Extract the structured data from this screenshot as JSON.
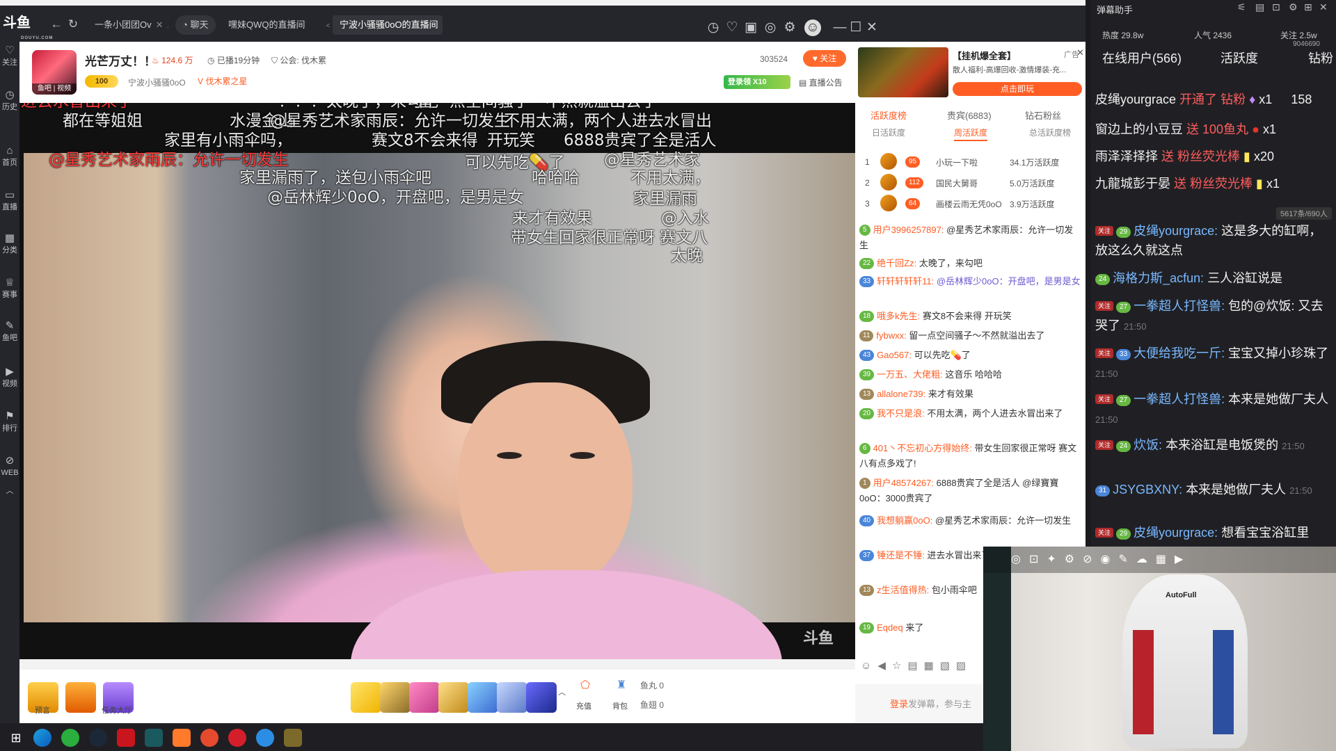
{
  "titlebar": {
    "logo": "斗鱼",
    "logo_sub": "DOUYU.COM",
    "tabs": [
      {
        "label": "一条小团团Ov"
      },
      {
        "label": "聊天"
      },
      {
        "label": "嘿妹QWQ的直播间"
      },
      {
        "label": "宁波小骚骚0oO的直播间"
      }
    ]
  },
  "rail": [
    {
      "label": "关注",
      "icon": "heart-icon"
    },
    {
      "label": "历史",
      "icon": "clock-icon"
    },
    {
      "label": "首页",
      "icon": "home-icon"
    },
    {
      "label": "直播",
      "icon": "tv-icon"
    },
    {
      "label": "分类",
      "icon": "grid-icon"
    },
    {
      "label": "赛事",
      "icon": "trophy-icon"
    },
    {
      "label": "鱼吧",
      "icon": "pen-icon"
    },
    {
      "label": "视频",
      "icon": "video-icon"
    },
    {
      "label": "排行",
      "icon": "bookmark-icon"
    },
    {
      "label": "WEB",
      "icon": "web-icon"
    }
  ],
  "room": {
    "avatar_tag": "鱼吧 | 视频",
    "title": "光芒万丈！！",
    "hot": "124.6 万",
    "duration": "已播19分钟",
    "guild": "公会: 伐木累",
    "level": "100",
    "streamer": "宁波小骚骚0oO",
    "fan_badge": "伐木累之星",
    "room_number": "303524",
    "follow": "关注",
    "login_gift": "登录领 X10",
    "announcement": "直播公告"
  },
  "ad": {
    "title": "【挂机爆全套】",
    "subtitle": "散人福利-高爆回收-激情爆装-充...",
    "cta": "点击即玩",
    "tag": "广告",
    "close": "✕"
  },
  "player": {
    "room_id": "斗鱼 房间号：796449",
    "watermark": "斗鱼",
    "danmu": [
      {
        "text": "进去水冒出来了",
        "red": true
      },
      {
        "text": "？？？太晚了，来勾吧",
        "red": false
      },
      {
        "text": "留一点空间骚子～不然就溢出去了",
        "red": false
      },
      {
        "text": "都在等姐姐",
        "red": false
      },
      {
        "text": "水漫金山",
        "red": false
      },
      {
        "text": "@星秀艺术家雨辰：允许一切发生",
        "red": false
      },
      {
        "text": "不用太满，两个人进去水冒出",
        "red": false
      },
      {
        "text": "家里有小雨伞吗，",
        "red": false
      },
      {
        "text": "赛文8不会来得",
        "red": false
      },
      {
        "text": "开玩笑",
        "red": false
      },
      {
        "text": "6888贵宾了全是活人",
        "red": false
      },
      {
        "text": "@星秀艺术家雨辰：允许一切发生",
        "red": true
      },
      {
        "text": "可以先吃💊了",
        "red": false
      },
      {
        "text": "@星秀艺术家",
        "red": false
      },
      {
        "text": "家里漏雨了，送包小雨伞吧",
        "red": false
      },
      {
        "text": "哈哈哈",
        "red": false
      },
      {
        "text": "不用太满，",
        "red": false
      },
      {
        "text": "@岳林辉少0oO，开盘吧，是男是女",
        "red": false
      },
      {
        "text": "家里漏雨",
        "red": false
      },
      {
        "text": "来才有效果",
        "red": false
      },
      {
        "text": "@入水",
        "red": false
      },
      {
        "text": "带女生回家很正常呀 赛文八",
        "red": false
      },
      {
        "text": "太晚",
        "red": false
      }
    ]
  },
  "player_bar": {
    "labels": [
      "预言",
      "任务大厅",
      "充值",
      "背包"
    ],
    "fish_ball": "鱼丸 0",
    "fish_fin": "鱼翅 0"
  },
  "chat": {
    "rank_tabs": [
      "活跃度榜",
      "贵宾(6883)",
      "钻石粉丝"
    ],
    "rank_subtabs": [
      "日活跃度",
      "周活跃度",
      "总活跃度榜"
    ],
    "ranks": [
      {
        "num": "1",
        "lv": "95",
        "name": "小玩一下啦",
        "score": "34.1万活跃度"
      },
      {
        "num": "2",
        "lv": "112",
        "name": "国民大舅哥",
        "score": "5.0万活跃度"
      },
      {
        "num": "3",
        "lv": "64",
        "name": "画楼云雨无凭0oO",
        "score": "3.9万活跃度"
      }
    ],
    "lines": [
      {
        "lv": "5",
        "name": "用户3996257897:",
        "text": "@星秀艺术家雨辰：允许一切发生"
      },
      {
        "lv": "22",
        "name": "绝千回Zz:",
        "text": "太晚了，来勾吧"
      },
      {
        "lv": "33",
        "name": "轩轩轩轩轩11:",
        "text": "@岳林辉少0oO：开盘吧，是男是女"
      },
      {
        "lv": "18",
        "name": "哦多k先生:",
        "text": "赛文8不会来得 开玩笑"
      },
      {
        "lv": "11",
        "name": "fybwxx:",
        "text": "留一点空间骚子～不然就溢出去了"
      },
      {
        "lv": "43",
        "name": "Gao567:",
        "text": "可以先吃💊了"
      },
      {
        "lv": "39",
        "name": "一万五、大佬粗:",
        "text": "这音乐 哈哈哈"
      },
      {
        "lv": "13",
        "name": "allalone739:",
        "text": "来才有效果"
      },
      {
        "lv": "20",
        "name": "我不只是浪:",
        "text": "不用太满，两个人进去水冒出来了"
      },
      {
        "lv": "6",
        "name": "401丶不忘初心方得始终:",
        "text": "带女生回家很正常呀 赛文八有点多戏了!"
      },
      {
        "lv": "1",
        "name": "用户48574267:",
        "text": "6888贵宾了全是活人 @绿寶寶0oO：3000贵宾了"
      },
      {
        "lv": "40",
        "name": "我想躺赢0oO:",
        "text": "@星秀艺术家雨辰：允许一切发生"
      },
      {
        "lv": "37",
        "name": "锤还是不锤:",
        "text": "进去水冒出来了"
      },
      {
        "lv": "13",
        "name": "z生活值得热:",
        "text": "包小雨伞吧"
      },
      {
        "lv": "19",
        "name": "Eqdeq",
        "text": "来了"
      }
    ],
    "input_prefix": "登录",
    "input_text": "发弹幕，参与主"
  },
  "assist": {
    "title": "弹幕助手",
    "hot": "热度 29.8w",
    "popularity": "人气 2436",
    "follow": "关注 2.5w",
    "follow_count": "9046690",
    "online": "在线用户(566)",
    "activity": "活跃度",
    "gift_tab": "钻粉",
    "gift_lines": [
      {
        "user": "皮绳yourgrace",
        "action": "开通了 钻粉",
        "count": "x1",
        "extra": "158"
      },
      {
        "user": "窗边上的小豆豆",
        "action": "送 100鱼丸",
        "count": "x1",
        "extra": ""
      },
      {
        "user": "雨泽泽择择",
        "action": "送 粉丝荧光棒",
        "count": "x20",
        "extra": ""
      },
      {
        "user": "九龍城彭于晏",
        "action": "送 粉丝荧光棒",
        "count": "x1",
        "extra": ""
      }
    ],
    "count_badge": "5617条/690人",
    "chat": [
      {
        "lv": "29",
        "name": "皮绳yourgrace:",
        "text": "这是多大的缸啊，放这么久就这点",
        "time": ""
      },
      {
        "lv": "24",
        "name": "海格力斯_acfun:",
        "text": "三人浴缸说是",
        "time": ""
      },
      {
        "lv": "27",
        "name": "一拳超人打怪兽:",
        "text": "包的@炊饭: 又去哭了",
        "time": "21:50"
      },
      {
        "lv": "33",
        "name": "大便给我吃一斤:",
        "text": "宝宝又掉小珍珠了",
        "time": "21:50"
      },
      {
        "lv": "27",
        "name": "一拳超人打怪兽:",
        "text": "本来是她做厂夫人",
        "time": "21:50"
      },
      {
        "lv": "24",
        "name": "炊饭:",
        "text": "本来浴缸是电饭煲的",
        "time": "21:50"
      },
      {
        "lv": "31",
        "name": "JSYGBXNY:",
        "text": "本来是她做厂夫人",
        "time": "21:50"
      },
      {
        "lv": "29",
        "name": "皮绳yourgrace:",
        "text": "想看宝宝浴缸里",
        "time": ""
      }
    ]
  },
  "cam": {
    "brand": "AutoFull"
  },
  "colors": {
    "accent": "#ff5d23",
    "titlebar": "#25262b",
    "assist_bg": "#202024"
  }
}
